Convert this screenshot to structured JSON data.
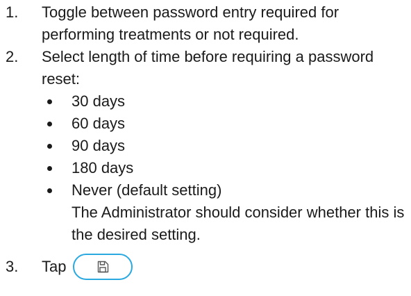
{
  "steps": [
    {
      "number": "1.",
      "text": "Toggle between password entry required for performing treatments or not required."
    },
    {
      "number": "2.",
      "text": "Select length of time before requiring a password reset:",
      "options": [
        "30 days",
        "60 days",
        "90 days",
        "180 days",
        "Never (default setting)"
      ],
      "default_note": "The Administrator should consider whether this is the desired setting."
    },
    {
      "number": "3.",
      "text": "Tap",
      "button_icon": "save-icon",
      "button_color": "#29a9e0"
    }
  ]
}
